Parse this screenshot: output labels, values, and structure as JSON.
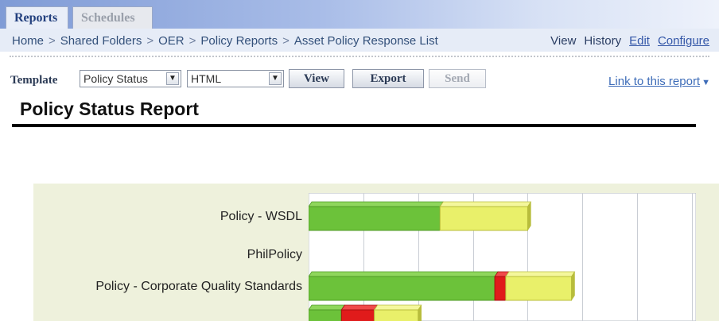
{
  "tabs": [
    {
      "label": "Reports",
      "active": true
    },
    {
      "label": "Schedules",
      "active": false
    }
  ],
  "breadcrumb": [
    "Home",
    "Shared Folders",
    "OER",
    "Policy Reports",
    "Asset Policy Response List"
  ],
  "breadcrumb_separator": ">",
  "actions": {
    "view": "View",
    "history": "History",
    "edit": "Edit",
    "configure": "Configure"
  },
  "toolbar": {
    "template_label": "Template",
    "template_value": "Policy Status",
    "format_value": "HTML",
    "view_button": "View",
    "export_button": "Export",
    "send_button": "Send",
    "link_to_report": "Link to this report"
  },
  "report_title": "Policy Status Report",
  "colors": {
    "green": "#6cc23a",
    "red": "#e01b1b",
    "yellow": "#e9f06a",
    "plot_bg": "#eef1dc"
  },
  "chart_data": {
    "type": "bar",
    "orientation": "horizontal",
    "stacked": true,
    "categories": [
      "Policy - WSDL",
      "PhilPolicy",
      "Policy - Corporate Quality Standards",
      ""
    ],
    "series": [
      {
        "color": "#6cc23a",
        "values": [
          2.4,
          0,
          3.4,
          0.6
        ]
      },
      {
        "color": "#e01b1b",
        "values": [
          0,
          0,
          0.2,
          0.6
        ]
      },
      {
        "color": "#e9f06a",
        "values": [
          1.6,
          0,
          1.2,
          0.8
        ]
      }
    ],
    "xlim": [
      0,
      7
    ],
    "grid": true
  }
}
